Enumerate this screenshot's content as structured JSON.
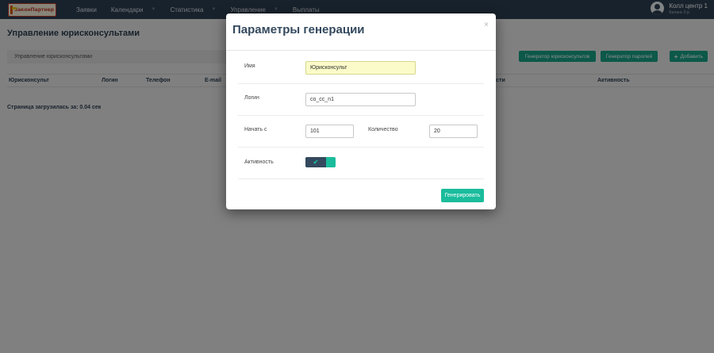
{
  "logo": {
    "text": "ЗаконПартнер"
  },
  "nav": {
    "items": [
      {
        "label": "Заявки",
        "has_caret": false
      },
      {
        "label": "Календари",
        "has_caret": true
      },
      {
        "label": "Статистика",
        "has_caret": true
      },
      {
        "label": "Управление",
        "has_caret": true
      },
      {
        "label": "Выплаты",
        "has_caret": false
      }
    ],
    "caret_glyph": "▼"
  },
  "user": {
    "name": "Колл центр 1",
    "balance": "Баланс 0 р."
  },
  "page": {
    "title": "Управление юрисконсультами",
    "breadcrumb": "Управление юрисконсультами",
    "load_time": "Страница загрузилась за: 0.04 сек"
  },
  "toolbar": {
    "generator_consultants": "Генератор юрисконсультов",
    "generator_passwords": "Генератор паролей",
    "add_label": "Добавить",
    "add_icon": "+"
  },
  "table": {
    "columns": [
      "Юрисконсульт",
      "Логин",
      "Телефон",
      "E-mail",
      "ости",
      "Активность"
    ]
  },
  "modal": {
    "title": "Параметры генерации",
    "close_glyph": "×",
    "fields": {
      "name_label": "Имя",
      "name_value": "Юрисконсульт",
      "login_label": "Логин",
      "login_value": "co_cc_n1",
      "start_label": "Начать с",
      "start_value": "101",
      "count_label": "Количество",
      "count_value": "20",
      "active_label": "Активность",
      "active_on": true,
      "check_glyph": "✔"
    },
    "submit_label": "Генерировать"
  },
  "colors": {
    "navbar": "#2c3e50",
    "accent": "#1abc9c",
    "button_green": "#16a085",
    "input_highlight": "#fbfbc9"
  }
}
